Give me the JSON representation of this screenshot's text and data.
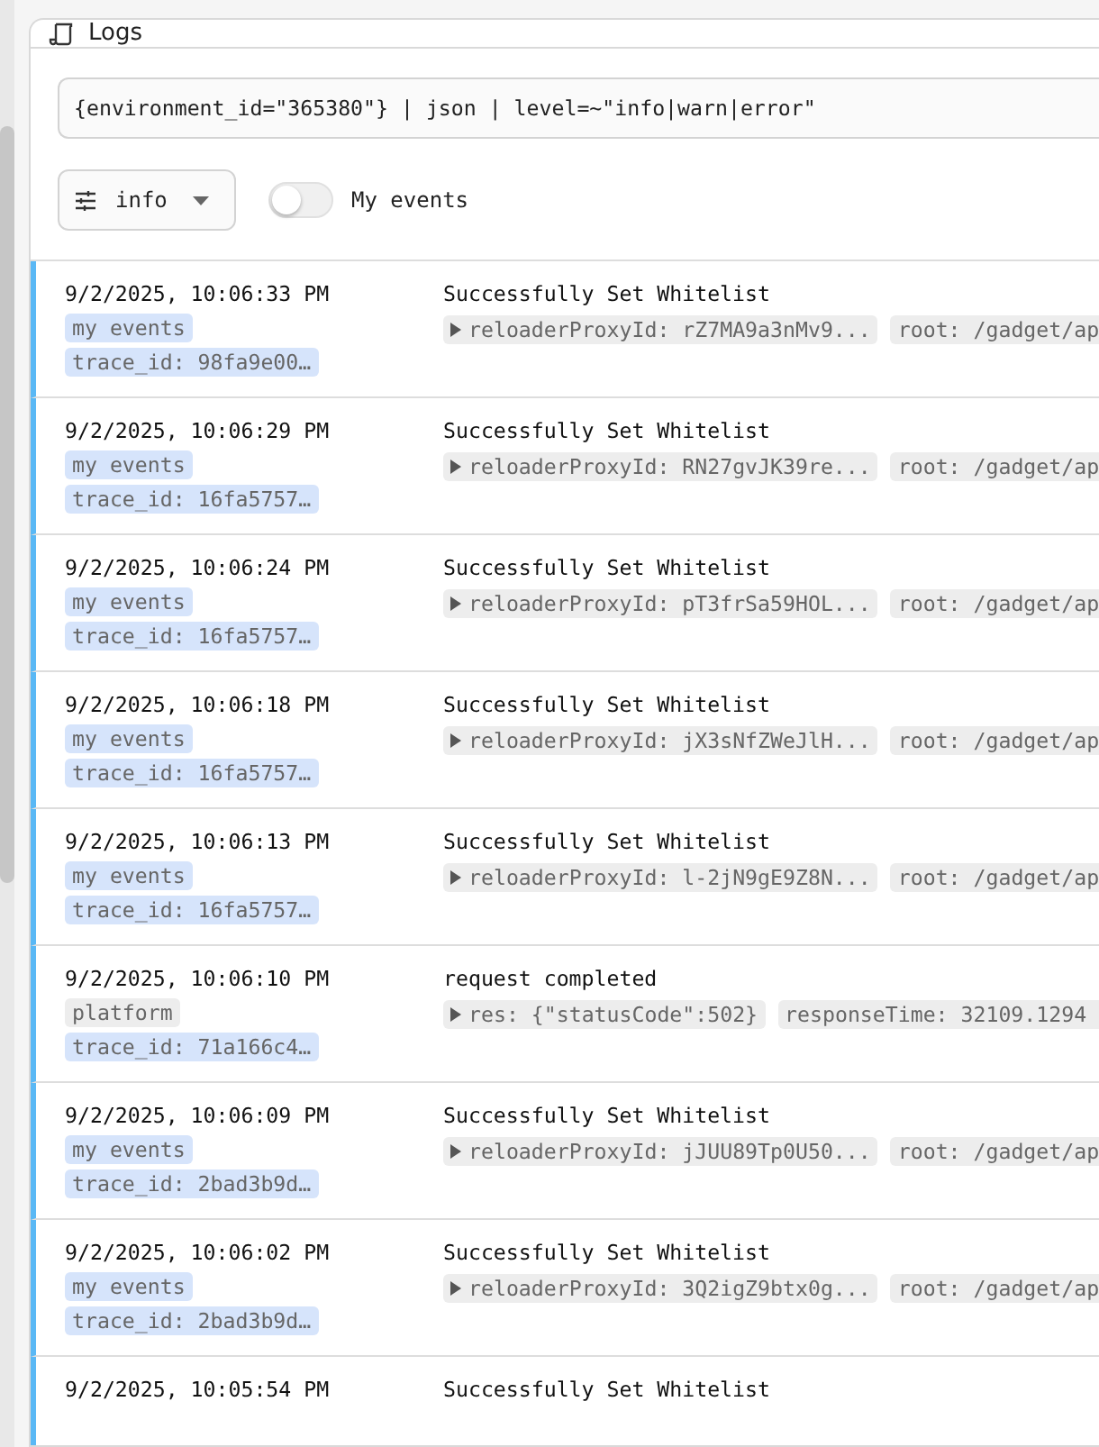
{
  "panel": {
    "title": "Logs"
  },
  "query": {
    "value": "{environment_id=\"365380\"} | json | level=~\"info|warn|error\""
  },
  "level_filter": {
    "value": "info"
  },
  "my_events_toggle": {
    "label": "My events",
    "on": false
  },
  "logs": [
    {
      "time": "9/2/2025, 10:06:33 PM",
      "tags": [
        {
          "text": "my events",
          "color": "#d6e4fb"
        },
        {
          "text": "trace_id: 98fa9e00…",
          "color": "#d6e4fb"
        }
      ],
      "message": "Successfully Set Whitelist",
      "fields": [
        {
          "text": "reloaderProxyId: rZ7MA9a3nMv9...",
          "expandable": true
        },
        {
          "text": "root: /gadget/ap",
          "expandable": false
        }
      ]
    },
    {
      "time": "9/2/2025, 10:06:29 PM",
      "tags": [
        {
          "text": "my events",
          "color": "#d6e4fb"
        },
        {
          "text": "trace_id: 16fa5757…",
          "color": "#d6e4fb"
        }
      ],
      "message": "Successfully Set Whitelist",
      "fields": [
        {
          "text": "reloaderProxyId: RN27gvJK39re...",
          "expandable": true
        },
        {
          "text": "root: /gadget/ap",
          "expandable": false
        }
      ]
    },
    {
      "time": "9/2/2025, 10:06:24 PM",
      "tags": [
        {
          "text": "my events",
          "color": "#d6e4fb"
        },
        {
          "text": "trace_id: 16fa5757…",
          "color": "#d6e4fb"
        }
      ],
      "message": "Successfully Set Whitelist",
      "fields": [
        {
          "text": "reloaderProxyId: pT3frSa59HOL...",
          "expandable": true
        },
        {
          "text": "root: /gadget/ap",
          "expandable": false
        }
      ]
    },
    {
      "time": "9/2/2025, 10:06:18 PM",
      "tags": [
        {
          "text": "my events",
          "color": "#d6e4fb"
        },
        {
          "text": "trace_id: 16fa5757…",
          "color": "#d6e4fb"
        }
      ],
      "message": "Successfully Set Whitelist",
      "fields": [
        {
          "text": "reloaderProxyId: jX3sNfZWeJlH...",
          "expandable": true
        },
        {
          "text": "root: /gadget/ap",
          "expandable": false
        }
      ]
    },
    {
      "time": "9/2/2025, 10:06:13 PM",
      "tags": [
        {
          "text": "my events",
          "color": "#d6e4fb"
        },
        {
          "text": "trace_id: 16fa5757…",
          "color": "#d6e4fb"
        }
      ],
      "message": "Successfully Set Whitelist",
      "fields": [
        {
          "text": "reloaderProxyId: l-2jN9gE9Z8N...",
          "expandable": true
        },
        {
          "text": "root: /gadget/ap",
          "expandable": false
        }
      ]
    },
    {
      "time": "9/2/2025, 10:06:10 PM",
      "tags": [
        {
          "text": "platform",
          "color": "#ededed"
        },
        {
          "text": "trace_id: 71a166c4…",
          "color": "#d6e4fb"
        }
      ],
      "message": "request completed",
      "fields": [
        {
          "text": "res: {\"statusCode\":502}",
          "expandable": true
        },
        {
          "text": "responseTime: 32109.1294",
          "expandable": false
        }
      ]
    },
    {
      "time": "9/2/2025, 10:06:09 PM",
      "tags": [
        {
          "text": "my events",
          "color": "#d6e4fb"
        },
        {
          "text": "trace_id: 2bad3b9d…",
          "color": "#d6e4fb"
        }
      ],
      "message": "Successfully Set Whitelist",
      "fields": [
        {
          "text": "reloaderProxyId: jJUU89Tp0U50...",
          "expandable": true
        },
        {
          "text": "root: /gadget/ap",
          "expandable": false
        }
      ]
    },
    {
      "time": "9/2/2025, 10:06:02 PM",
      "tags": [
        {
          "text": "my events",
          "color": "#d6e4fb"
        },
        {
          "text": "trace_id: 2bad3b9d…",
          "color": "#d6e4fb"
        }
      ],
      "message": "Successfully Set Whitelist",
      "fields": [
        {
          "text": "reloaderProxyId: 3Q2igZ9btx0g...",
          "expandable": true
        },
        {
          "text": "root: /gadget/ap",
          "expandable": false
        }
      ]
    },
    {
      "time": "9/2/2025, 10:05:54 PM",
      "message": "Successfully Set Whitelist"
    }
  ]
}
